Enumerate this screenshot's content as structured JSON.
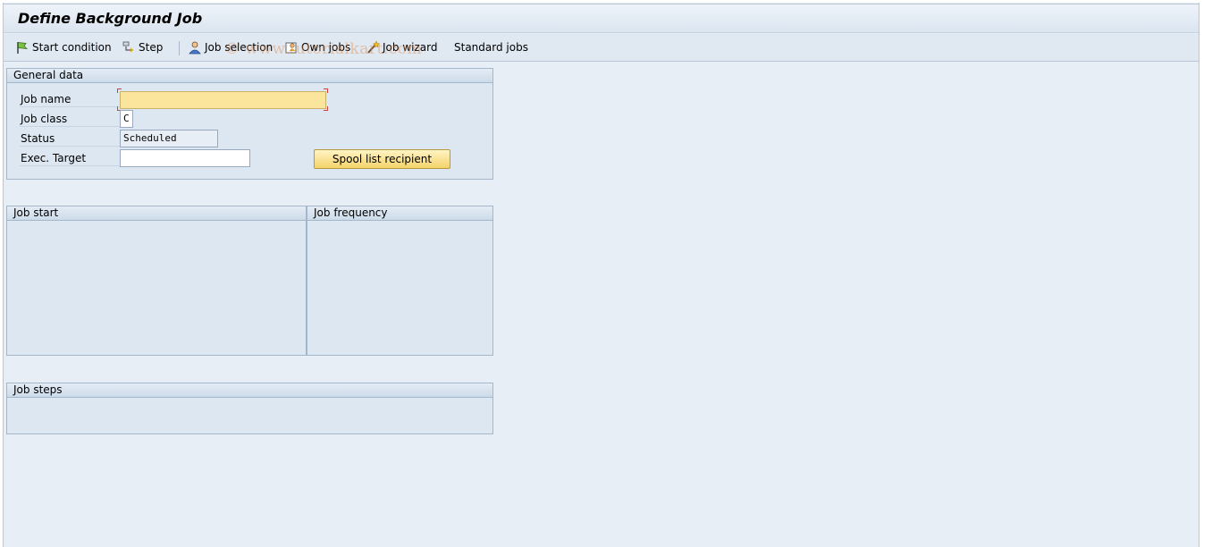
{
  "window": {
    "title": "Define Background Job"
  },
  "toolbar": {
    "start_condition": "Start condition",
    "step": "Step",
    "job_selection": "Job selection",
    "own_jobs": "Own jobs",
    "job_wizard": "Job wizard",
    "standard_jobs": "Standard jobs"
  },
  "watermark": "© www.tutorialkart.com",
  "general_data": {
    "heading": "General data",
    "job_name_label": "Job name",
    "job_name_value": "",
    "job_class_label": "Job class",
    "job_class_value": "C",
    "status_label": "Status",
    "status_value": "Scheduled",
    "exec_target_label": "Exec. Target",
    "exec_target_value": "",
    "spool_button": "Spool list recipient"
  },
  "job_start": {
    "heading": "Job start"
  },
  "job_frequency": {
    "heading": "Job frequency"
  },
  "job_steps": {
    "heading": "Job steps"
  },
  "colors": {
    "background": "#e8eef6",
    "group_background": "#dde7f1",
    "required_field": "#fbe59d",
    "button": "#f5d36a"
  }
}
